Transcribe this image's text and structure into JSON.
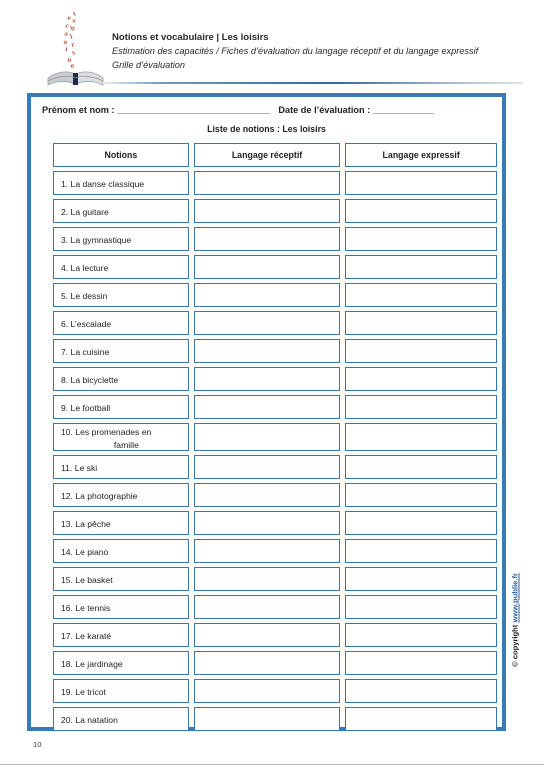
{
  "header": {
    "logo_icon": "open-book-with-rising-letters-icon",
    "title": "Notions et vocabulaire | Les loisirs",
    "subtitle_1": "Estimation des capacités / Fiches d’évaluation du langage réceptif et du langage expressif",
    "subtitle_2": "Grille d’évaluation"
  },
  "form": {
    "name_label": "Prénom et nom : ",
    "name_line": "______________________________",
    "date_label": "Date de l’évaluation : ",
    "date_line": "____________",
    "list_title": "Liste de notions : Les loisirs"
  },
  "table": {
    "columns": [
      "Notions",
      "Langage réceptif",
      "Langage expressif"
    ],
    "rows": [
      {
        "n": "1.",
        "label": "1. La danse classique",
        "receptif": "",
        "expressif": ""
      },
      {
        "n": "2.",
        "label": "2. La guitare",
        "receptif": "",
        "expressif": ""
      },
      {
        "n": "3.",
        "label": "3. La gymnastique",
        "receptif": "",
        "expressif": ""
      },
      {
        "n": "4.",
        "label": "4. La lecture",
        "receptif": "",
        "expressif": ""
      },
      {
        "n": "5.",
        "label": "5. Le dessin",
        "receptif": "",
        "expressif": ""
      },
      {
        "n": "6.",
        "label": "6. L’escalade",
        "receptif": "",
        "expressif": ""
      },
      {
        "n": "7.",
        "label": "7. La cuisine",
        "receptif": "",
        "expressif": ""
      },
      {
        "n": "8.",
        "label": "8. La bicyclette",
        "receptif": "",
        "expressif": ""
      },
      {
        "n": "9.",
        "label": "9. Le football",
        "receptif": "",
        "expressif": ""
      },
      {
        "n": "10.",
        "label": "10. Les promenades en famille",
        "label_line1": "10. Les promenades en",
        "label_line2": "famille",
        "receptif": "",
        "expressif": ""
      },
      {
        "n": "11.",
        "label": "11. Le ski",
        "receptif": "",
        "expressif": ""
      },
      {
        "n": "12.",
        "label": "12. La photographie",
        "receptif": "",
        "expressif": ""
      },
      {
        "n": "13.",
        "label": "13. La pêche",
        "receptif": "",
        "expressif": ""
      },
      {
        "n": "14.",
        "label": "14. Le piano",
        "receptif": "",
        "expressif": ""
      },
      {
        "n": "15.",
        "label": "15. Le basket",
        "receptif": "",
        "expressif": ""
      },
      {
        "n": "16.",
        "label": "16. Le tennis",
        "receptif": "",
        "expressif": ""
      },
      {
        "n": "17.",
        "label": "17. Le karaté",
        "receptif": "",
        "expressif": ""
      },
      {
        "n": "18.",
        "label": "18. Le jardinage",
        "receptif": "",
        "expressif": ""
      },
      {
        "n": "19.",
        "label": "19. Le tricot",
        "receptif": "",
        "expressif": ""
      },
      {
        "n": "20.",
        "label": "20. La natation",
        "receptif": "",
        "expressif": ""
      }
    ]
  },
  "footer": {
    "copyright_prefix": "© copyright ",
    "copyright_url": "www.publie.fr",
    "page_number": "10"
  },
  "colors": {
    "frame_blue": "#3b7bb5",
    "cell_border_blue": "#3a75a8",
    "link_blue": "#2c5f9e",
    "text": "#231f20",
    "logo_letters": "#b4533a"
  }
}
